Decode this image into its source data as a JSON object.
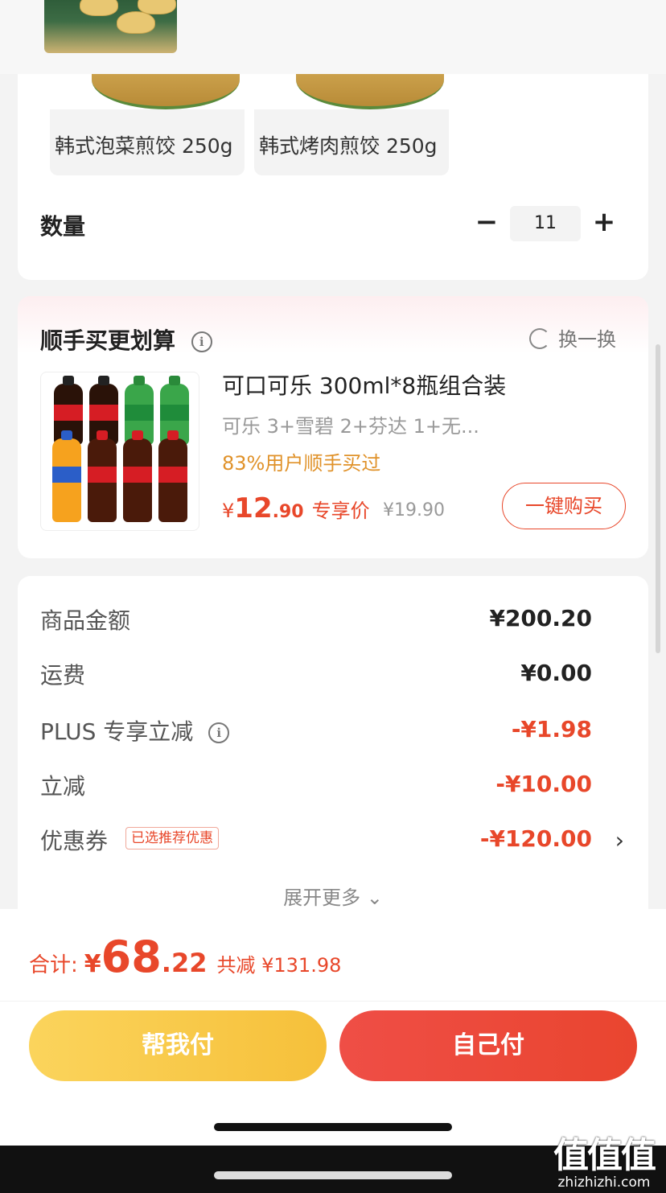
{
  "products": [
    {
      "name": "韩式泡菜煎饺 250g"
    },
    {
      "name": "韩式烤肉煎饺 250g"
    }
  ],
  "quantity": {
    "label": "数量",
    "minus": "−",
    "value": "11",
    "plus": "+"
  },
  "upsell": {
    "title": "顺手买更划算",
    "info_icon": "i",
    "refresh_label": "换一换",
    "product": {
      "name": "可口可乐 300ml*8瓶组合装",
      "desc": "可乐 3+雪碧 2+芬达 1+无...",
      "popularity": "83%用户顺手买过",
      "price_currency": "¥",
      "price_int": "12",
      "price_dec": ".90",
      "price_tag": "专享价",
      "original_price": "¥19.90"
    },
    "buy_button": "一键购买"
  },
  "summary": {
    "rows": [
      {
        "label": "商品金额",
        "value": "¥200.20"
      },
      {
        "label": "运费",
        "value": "¥0.00"
      },
      {
        "label": "PLUS 专享立减",
        "value": "-¥1.98"
      },
      {
        "label": "立减",
        "value": "-¥10.00"
      },
      {
        "label": "优惠券",
        "value": "-¥120.00"
      }
    ],
    "coupon_badge": "已选推荐优惠",
    "chevron": "›",
    "expand_more": "展开更多 ⌄"
  },
  "footer": {
    "total_label": "合计:",
    "total_currency": "¥",
    "total_int": "68",
    "total_dec": ".22",
    "saved": "共减 ¥131.98",
    "help_pay": "帮我付",
    "self_pay": "自己付"
  },
  "watermark": {
    "big": "值值值",
    "small": "zhizhizhi.com"
  },
  "colors": {
    "accent": "#e8472a",
    "gold": "#f6c03a",
    "orange_text": "#e0922a"
  }
}
